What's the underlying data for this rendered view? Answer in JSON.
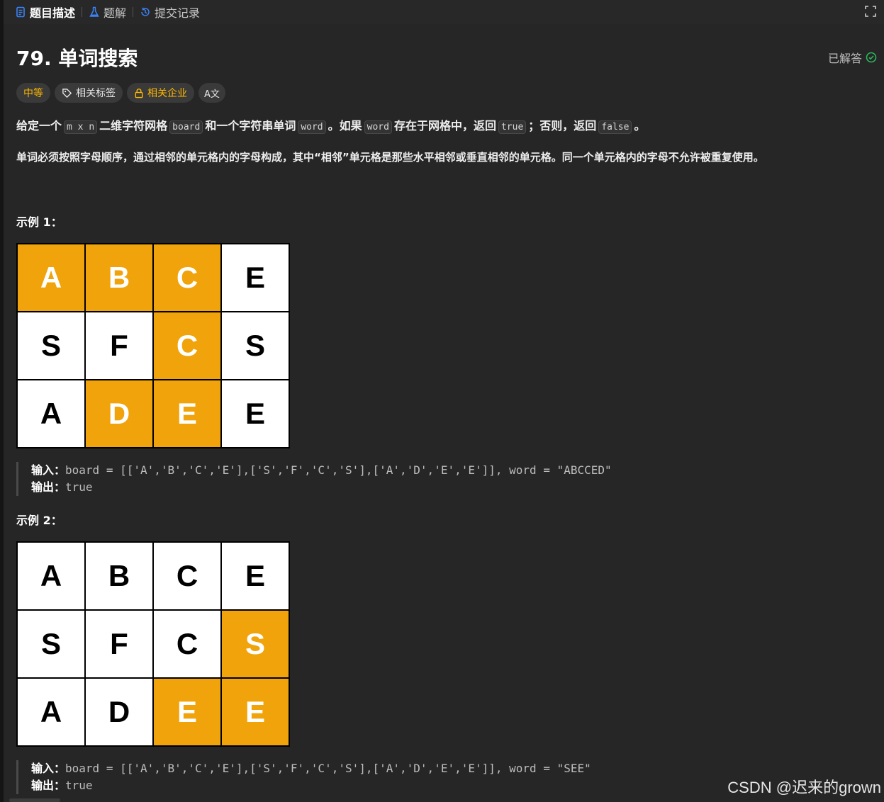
{
  "tabs": [
    {
      "label": "题目描述",
      "icon": "description-icon",
      "active": true
    },
    {
      "label": "题解",
      "icon": "flask-icon",
      "active": false
    },
    {
      "label": "提交记录",
      "icon": "history-icon",
      "active": false
    }
  ],
  "problem": {
    "title": "79. 单词搜索",
    "status": "已解答",
    "tags": {
      "difficulty": "中等",
      "related_tags": "相关标签",
      "related_companies": "相关企业",
      "lang": "A文"
    },
    "desc1": {
      "t1": "给定一个",
      "c1": "m x n",
      "t2": "二维字符网格",
      "c2": "board",
      "t3": "和一个字符串单词",
      "c3": "word",
      "t4": "。如果",
      "c4": "word",
      "t5": "存在于网格中，返回",
      "c5": "true",
      "t6": "；否则，返回",
      "c6": "false",
      "t7": "。"
    },
    "desc2": "单词必须按照字母顺序，通过相邻的单元格内的字母构成，其中“相邻”单元格是那些水平相邻或垂直相邻的单元格。同一个单元格内的字母不允许被重复使用。"
  },
  "examples": [
    {
      "title": "示例 1：",
      "grid": [
        [
          "A",
          "B",
          "C",
          "E"
        ],
        [
          "S",
          "F",
          "C",
          "S"
        ],
        [
          "A",
          "D",
          "E",
          "E"
        ]
      ],
      "highlight": [
        [
          0,
          0
        ],
        [
          0,
          1
        ],
        [
          0,
          2
        ],
        [
          1,
          2
        ],
        [
          2,
          1
        ],
        [
          2,
          2
        ]
      ],
      "input_label": "输入：",
      "input": "board = [['A','B','C','E'],['S','F','C','S'],['A','D','E','E']], word = \"ABCCED\"",
      "output_label": "输出：",
      "output": "true"
    },
    {
      "title": "示例 2：",
      "grid": [
        [
          "A",
          "B",
          "C",
          "E"
        ],
        [
          "S",
          "F",
          "C",
          "S"
        ],
        [
          "A",
          "D",
          "E",
          "E"
        ]
      ],
      "highlight": [
        [
          1,
          3
        ],
        [
          2,
          2
        ],
        [
          2,
          3
        ]
      ],
      "input_label": "输入：",
      "input": "board = [['A','B','C','E'],['S','F','C','S'],['A','D','E','E']], word = \"SEE\"",
      "output_label": "输出：",
      "output": "true"
    }
  ],
  "watermark": "CSDN @迟来的grown",
  "colors": {
    "highlight": "#f0a30a",
    "accent_blue": "#3b82f6",
    "difficulty": "#ffb800",
    "solved_green": "#2db55d"
  }
}
